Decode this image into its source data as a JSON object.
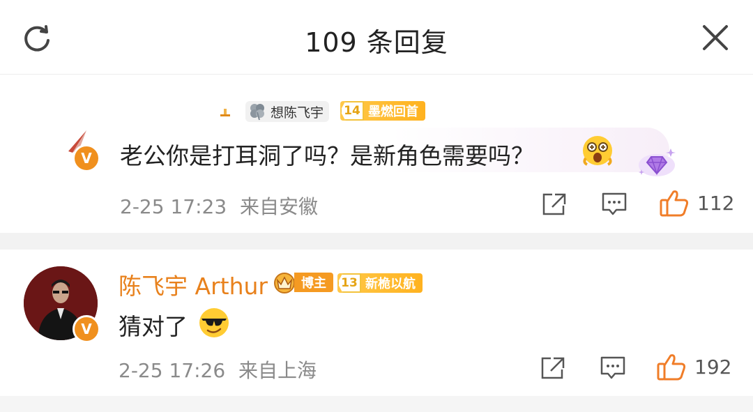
{
  "header": {
    "title": "109 条回复",
    "refresh_icon": "refresh-icon",
    "close_icon": "close-icon"
  },
  "comments": [
    {
      "reply_to": {
        "name": "想陈飞宇",
        "level": "14",
        "badge": "墨燃回首"
      },
      "text": "老公你是打耳洞了吗？是新角色需要吗？",
      "emoji": "surprised-face-emoji",
      "sticker": "purple-gem-sticker",
      "time": "2-25 17:23",
      "location": "来自安徽",
      "likes": "112"
    },
    {
      "username": "陈飞宇 Arthur",
      "badge_blogger": "博主",
      "level": "13",
      "badge": "新桅以航",
      "text": "猜对了",
      "emoji": "sunglasses-face-emoji",
      "time": "2-25 17:26",
      "location": "来自上海",
      "likes": "192"
    }
  ],
  "colors": {
    "accent": "#e8811c",
    "verified": "#f0901e",
    "level_bg": "#ffb21f",
    "like": "#f07d28"
  }
}
